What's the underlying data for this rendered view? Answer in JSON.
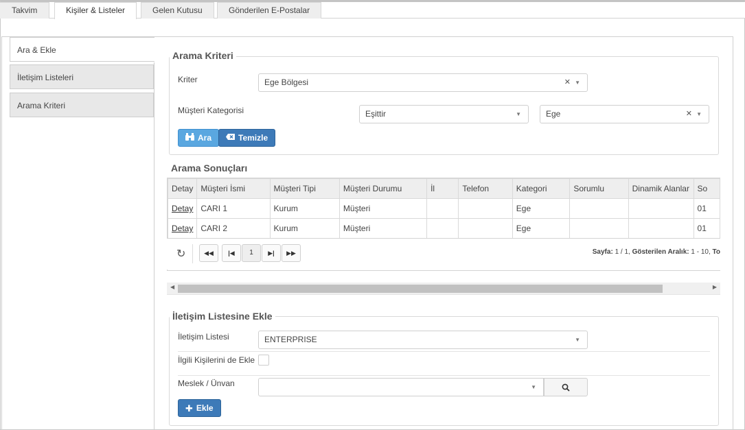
{
  "tabs": [
    {
      "label": "Takvim"
    },
    {
      "label": "Kişiler & Listeler"
    },
    {
      "label": "Gelen Kutusu"
    },
    {
      "label": "Gönderilen E-Postalar"
    }
  ],
  "sidebar": {
    "items": [
      {
        "label": "Ara & Ekle"
      },
      {
        "label": "İletişim Listeleri"
      },
      {
        "label": "Arama Kriteri"
      }
    ]
  },
  "criteria": {
    "legend": "Arama Kriteri",
    "kriter_label": "Kriter",
    "kriter_value": "Ege Bölgesi",
    "kategori_label": "Müşteri Kategorisi",
    "operator_value": "Eşittir",
    "kategori_value": "Ege",
    "search_label": "Ara",
    "clear_label": "Temizle"
  },
  "results": {
    "title": "Arama Sonuçları",
    "columns": [
      "Detay",
      "Müşteri İsmi",
      "Müşteri Tipi",
      "Müşteri Durumu",
      "İl",
      "Telefon",
      "Kategori",
      "Sorumlu",
      "Dinamik Alanlar",
      "So"
    ],
    "rows": [
      [
        "Detay",
        "CARI 1",
        "Kurum",
        "Müşteri",
        "",
        "",
        "Ege",
        "",
        "",
        "01"
      ],
      [
        "Detay",
        "CARI 2",
        "Kurum",
        "Müşteri",
        "",
        "",
        "Ege",
        "",
        "",
        "01"
      ]
    ],
    "pager": {
      "current_page": "1",
      "info_label_page": "Sayfa:",
      "info_page": "1 / 1,",
      "info_label_range": "Gösterilen Aralık:",
      "info_range": "1 - 10,",
      "info_trailing": "To"
    }
  },
  "add_list": {
    "legend": "İletişim Listesine Ekle",
    "list_label": "İletişim Listesi",
    "list_value": "ENTERPRISE",
    "related_label": "İlgili Kişilerini de Ekle",
    "job_label": "Meslek / Ünvan",
    "job_value": "",
    "add_label": "Ekle"
  }
}
